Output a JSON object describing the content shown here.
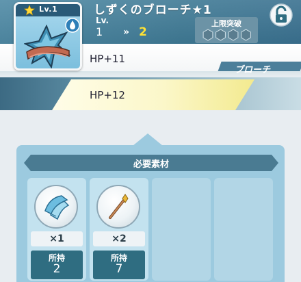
{
  "item": {
    "name": "しずくのブローチ★1",
    "card_level": "Lv.1",
    "level_label": "Lv.",
    "level_current": "1",
    "level_arrow": "»",
    "level_next": "2",
    "limit_break_label": "上限突破",
    "limit_break_count": 4,
    "type": "ブローチ",
    "icon": "brooch-icon",
    "element_icon": "water-drop-icon"
  },
  "stats": {
    "current": "HP+11",
    "next": "HP+12"
  },
  "materials": {
    "title": "必要素材",
    "owned_label": "所持",
    "slots": [
      {
        "icon": "cloth-material-icon",
        "quantity": "×1",
        "owned": "2"
      },
      {
        "icon": "wand-material-icon",
        "quantity": "×2",
        "owned": "7"
      }
    ]
  },
  "colors": {
    "header": "#4f8aa5",
    "accent_yellow": "#ffe234",
    "panel": "#9ccadf",
    "owned_bg": "#2f6d81"
  }
}
